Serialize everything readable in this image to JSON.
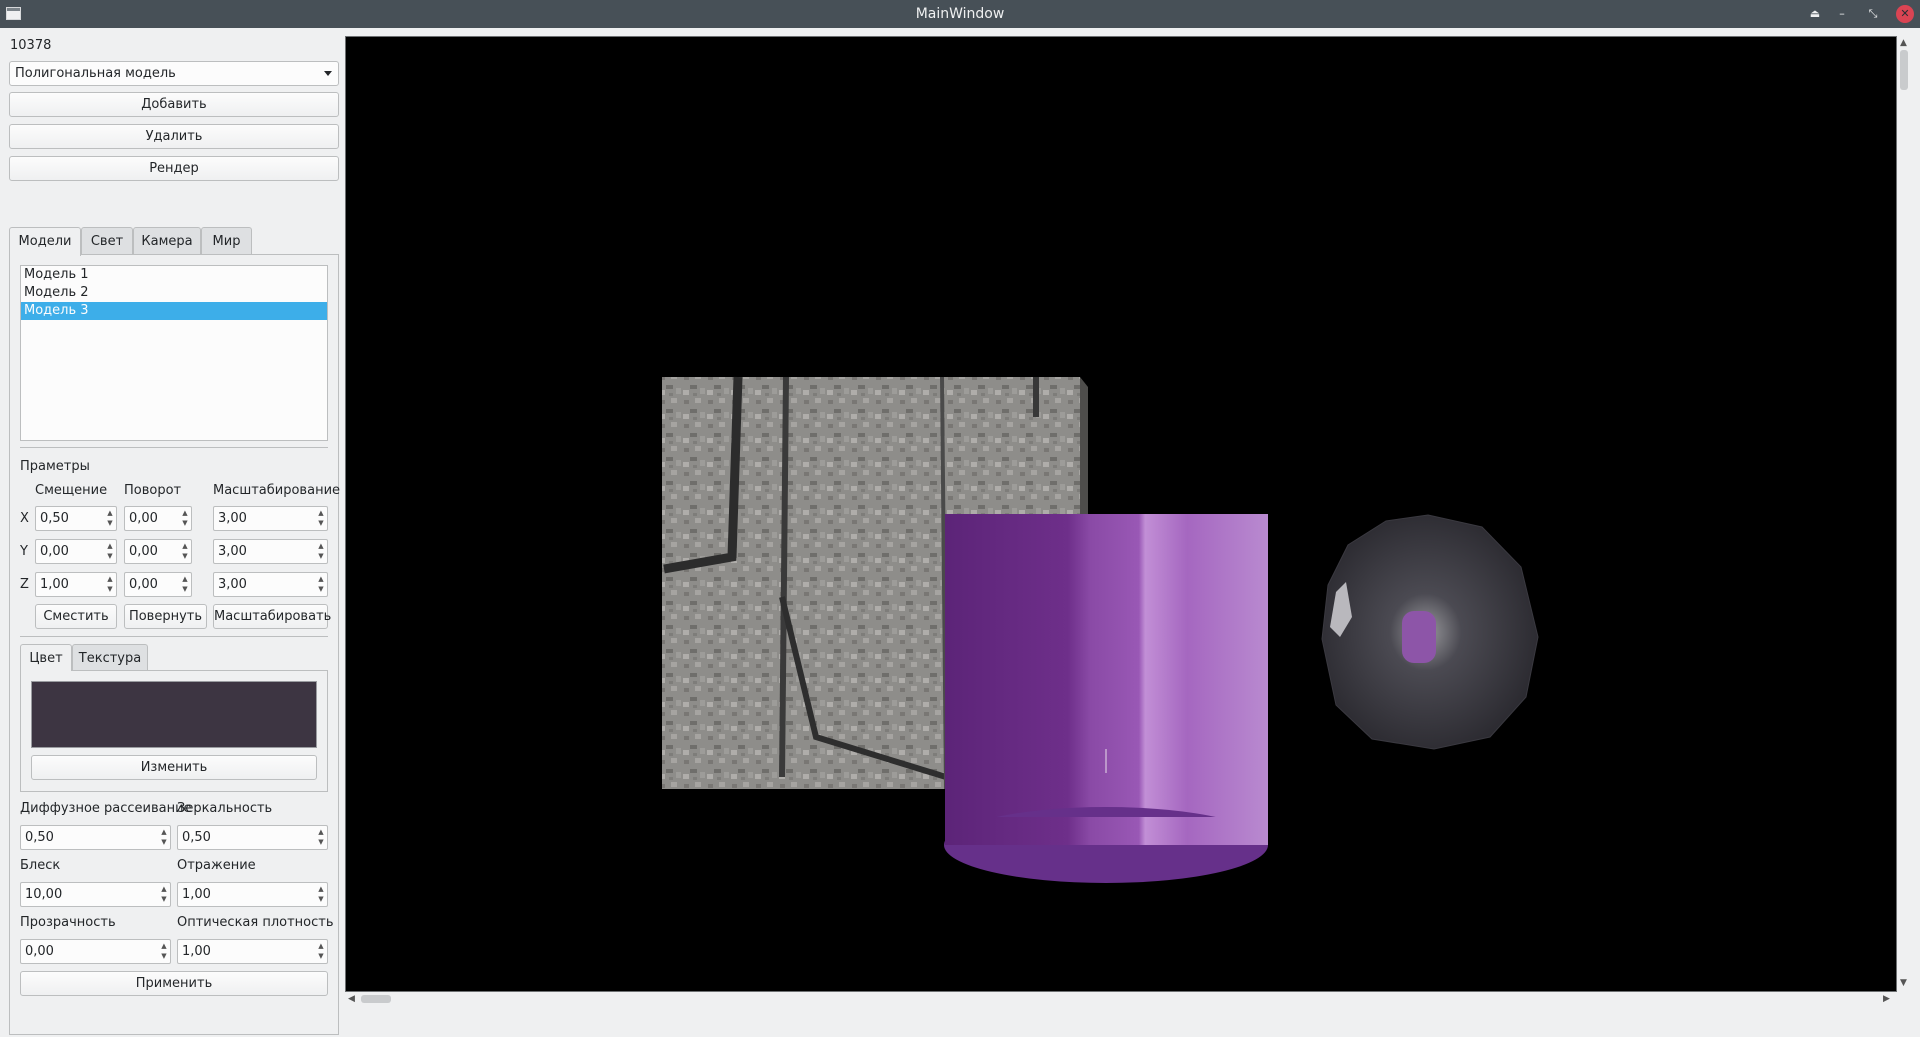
{
  "window": {
    "title": "MainWindow"
  },
  "panel": {
    "serial": "10378",
    "model_type": "Полигональная модель",
    "add_label": "Добавить",
    "remove_label": "Удалить",
    "render_label": "Рендер"
  },
  "tabs": [
    "Модели",
    "Свет",
    "Камера",
    "Мир"
  ],
  "models": {
    "items": [
      "Модель 1",
      "Модель 2",
      "Модель 3"
    ],
    "selected_index": 2
  },
  "params": {
    "heading": "Праметры",
    "col_translate": "Смещение",
    "col_rotate": "Поворот",
    "col_scale": "Масштабирование",
    "axes": [
      "X",
      "Y",
      "Z"
    ],
    "translate": [
      "0,50",
      "0,00",
      "1,00"
    ],
    "rotate": [
      "0,00",
      "0,00",
      "0,00"
    ],
    "scale": [
      "3,00",
      "3,00",
      "3,00"
    ],
    "btn_translate": "Сместить",
    "btn_rotate": "Повернуть",
    "btn_scale": "Масштабировать"
  },
  "material_tabs": [
    "Цвет",
    "Текстура"
  ],
  "material": {
    "color": "#3d3542",
    "change_label": "Изменить",
    "diffuse_label": "Диффузное рассеивание",
    "diffuse": "0,50",
    "specular_label": "Зеркальность",
    "specular": "0,50",
    "shininess_label": "Блеск",
    "shininess": "10,00",
    "reflection_label": "Отражение",
    "reflection": "1,00",
    "transparency_label": "Прозрачность",
    "transparency": "0,00",
    "density_label": "Оптическая плотность",
    "density": "1,00",
    "apply_label": "Применить"
  },
  "colors": {
    "selection": "#3daee9",
    "titlebar": "#475057",
    "close": "#da4453",
    "cylinder": "#6b2f86"
  }
}
